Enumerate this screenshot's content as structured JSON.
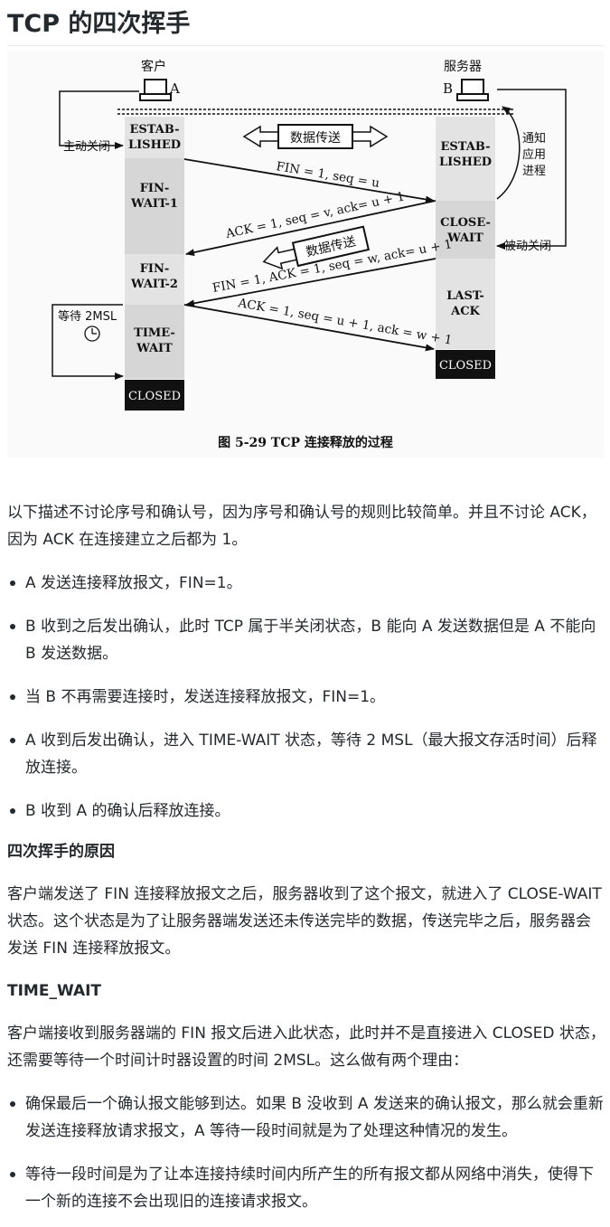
{
  "title": "TCP 的四次挥手",
  "figure": {
    "client_label": "客户",
    "client_letter": "A",
    "server_label": "服务器",
    "server_letter": "B",
    "active_close": "主动关闭",
    "passive_close": "被动关闭",
    "notify_app": [
      "通知",
      "应用",
      "进程"
    ],
    "wait_2msl": "等待 2MSL",
    "data_transfer": "数据传送",
    "data_transfer_2": "数据传送",
    "client_states": [
      "ESTAB-",
      "LISHED",
      "FIN-",
      "WAIT-1",
      "FIN-",
      "WAIT-2",
      "TIME-",
      "WAIT",
      "CLOSED"
    ],
    "server_states": [
      "ESTAB-",
      "LISHED",
      "CLOSE-",
      "WAIT",
      "LAST-",
      "ACK",
      "CLOSED"
    ],
    "msg1": "FIN = 1, seq = u",
    "msg2": "ACK = 1, seq = v, ack= u + 1",
    "msg3": "FIN = 1, ACK = 1, seq = w, ack= u + 1",
    "msg4": "ACK = 1, seq = u + 1, ack = w + 1",
    "caption": "图 5-29    TCP 连接释放的过程"
  },
  "intro": "以下描述不讨论序号和确认号，因为序号和确认号的规则比较简单。并且不讨论 ACK，因为 ACK 在连接建立之后都为 1。",
  "steps": [
    "A 发送连接释放报文，FIN=1。",
    "B 收到之后发出确认，此时 TCP 属于半关闭状态，B 能向 A 发送数据但是 A 不能向 B 发送数据。",
    "当 B 不再需要连接时，发送连接释放报文，FIN=1。",
    "A 收到后发出确认，进入 TIME-WAIT 状态，等待 2 MSL（最大报文存活时间）后释放连接。",
    "B 收到 A 的确认后释放连接。"
  ],
  "reason_heading": "四次挥手的原因",
  "reason_text": "客户端发送了 FIN 连接释放报文之后，服务器收到了这个报文，就进入了 CLOSE-WAIT 状态。这个状态是为了让服务器端发送还未传送完毕的数据，传送完毕之后，服务器会发送 FIN 连接释放报文。",
  "tw_heading": "TIME_WAIT",
  "tw_text": "客户端接收到服务器端的 FIN 报文后进入此状态，此时并不是直接进入 CLOSED 状态，还需要等待一个时间计时器设置的时间 2MSL。这么做有两个理由：",
  "tw_reasons": [
    "确保最后一个确认报文能够到达。如果 B 没收到 A 发送来的确认报文，那么就会重新发送连接释放请求报文，A 等待一段时间就是为了处理这种情况的发生。",
    "等待一段时间是为了让本连接持续时间内所产生的所有报文都从网络中消失，使得下一个新的连接不会出现旧的连接请求报文。"
  ]
}
